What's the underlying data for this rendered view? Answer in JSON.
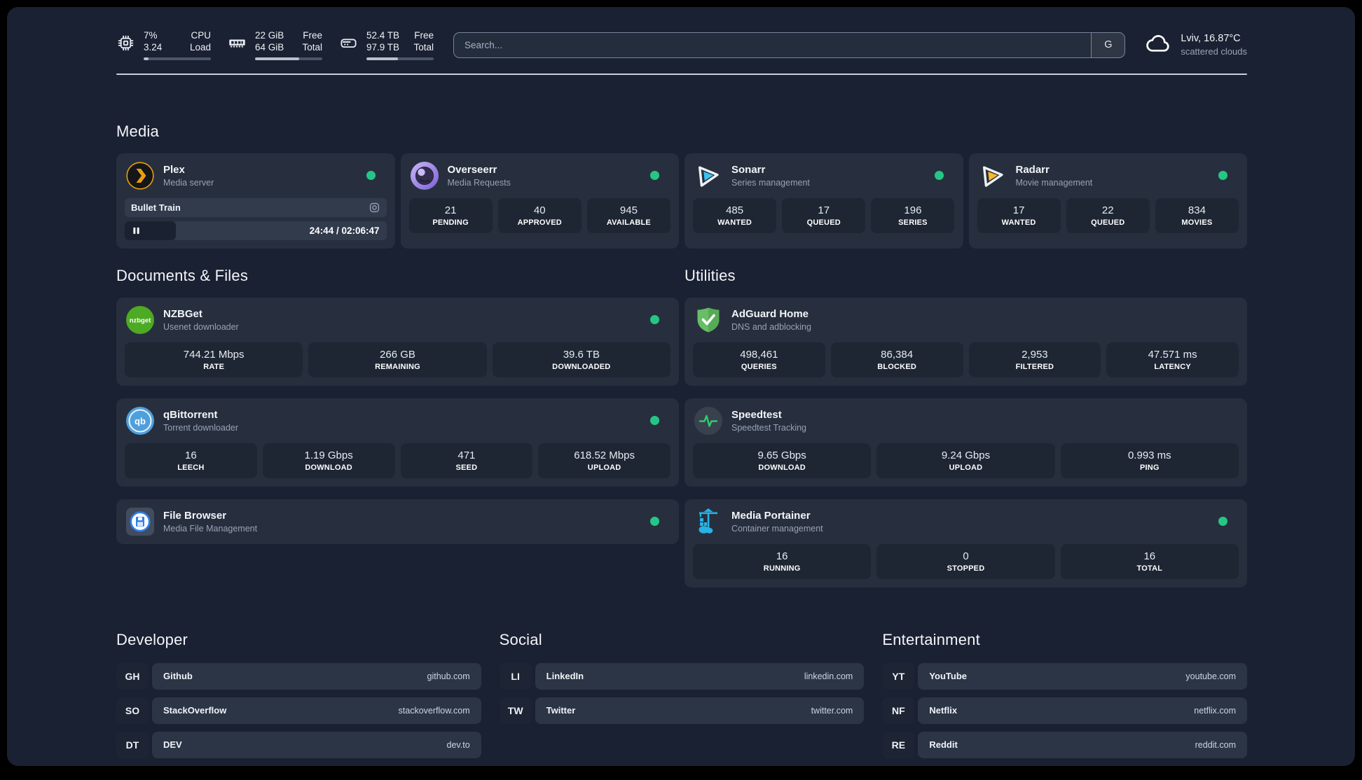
{
  "colors": {
    "status_online": "#25c685",
    "plex_accent": "#e5a00d",
    "sonarr_accent": "#38c3f3",
    "radarr_accent": "#fdb924",
    "nzbget_accent": "#4daa23",
    "qbittorrent_accent": "#4f9fdc",
    "adguard_accent": "#57b358",
    "speedtest_accent": "#2ecc71",
    "portainer_accent": "#29b2e4"
  },
  "header": {
    "stats": [
      {
        "icon": "cpu-icon",
        "rows": [
          [
            "7%",
            "CPU"
          ],
          [
            "3.24",
            "Load"
          ]
        ],
        "progress_pct": 7
      },
      {
        "icon": "ram-icon",
        "rows": [
          [
            "22 GiB",
            "Free"
          ],
          [
            "64 GiB",
            "Total"
          ]
        ],
        "progress_pct": 66
      },
      {
        "icon": "disk-icon",
        "rows": [
          [
            "52.4 TB",
            "Free"
          ],
          [
            "97.9 TB",
            "Total"
          ]
        ],
        "progress_pct": 47
      }
    ],
    "search": {
      "placeholder": "Search...",
      "engine_label": "G"
    },
    "weather": {
      "icon": "cloud-icon",
      "location_temp": "Lviv, 16.87°C",
      "condition": "scattered clouds"
    }
  },
  "sections": {
    "media": {
      "title": "Media",
      "apps": [
        {
          "id": "plex",
          "name": "Plex",
          "subtitle": "Media server",
          "icon": "plex-icon",
          "online": true,
          "now_playing": {
            "title": "Bullet Train",
            "time_display": "24:44 / 02:06:47",
            "progress_pct": 19.5
          }
        },
        {
          "id": "overseerr",
          "name": "Overseerr",
          "subtitle": "Media Requests",
          "icon": "overseerr-icon",
          "online": true,
          "stats": [
            {
              "value": "21",
              "label": "PENDING"
            },
            {
              "value": "40",
              "label": "APPROVED"
            },
            {
              "value": "945",
              "label": "AVAILABLE"
            }
          ]
        },
        {
          "id": "sonarr",
          "name": "Sonarr",
          "subtitle": "Series management",
          "icon": "sonarr-icon",
          "online": true,
          "stats": [
            {
              "value": "485",
              "label": "WANTED"
            },
            {
              "value": "17",
              "label": "QUEUED"
            },
            {
              "value": "196",
              "label": "SERIES"
            }
          ]
        },
        {
          "id": "radarr",
          "name": "Radarr",
          "subtitle": "Movie management",
          "icon": "radarr-icon",
          "online": true,
          "stats": [
            {
              "value": "17",
              "label": "WANTED"
            },
            {
              "value": "22",
              "label": "QUEUED"
            },
            {
              "value": "834",
              "label": "MOVIES"
            }
          ]
        }
      ]
    },
    "documents": {
      "title": "Documents & Files",
      "apps": [
        {
          "id": "nzbget",
          "name": "NZBGet",
          "subtitle": "Usenet downloader",
          "icon": "nzbget-icon",
          "online": true,
          "stats": [
            {
              "value": "744.21 Mbps",
              "label": "RATE"
            },
            {
              "value": "266 GB",
              "label": "REMAINING"
            },
            {
              "value": "39.6 TB",
              "label": "DOWNLOADED"
            }
          ]
        },
        {
          "id": "qbittorrent",
          "name": "qBittorrent",
          "subtitle": "Torrent downloader",
          "icon": "qbittorrent-icon",
          "online": true,
          "stats": [
            {
              "value": "16",
              "label": "LEECH"
            },
            {
              "value": "1.19 Gbps",
              "label": "DOWNLOAD"
            },
            {
              "value": "471",
              "label": "SEED"
            },
            {
              "value": "618.52 Mbps",
              "label": "UPLOAD"
            }
          ]
        },
        {
          "id": "filebrowser",
          "name": "File Browser",
          "subtitle": "Media File Management",
          "icon": "filebrowser-icon",
          "online": true
        }
      ]
    },
    "utilities": {
      "title": "Utilities",
      "apps": [
        {
          "id": "adguard",
          "name": "AdGuard Home",
          "subtitle": "DNS and adblocking",
          "icon": "adguard-icon",
          "online": false,
          "stats": [
            {
              "value": "498,461",
              "label": "QUERIES"
            },
            {
              "value": "86,384",
              "label": "BLOCKED"
            },
            {
              "value": "2,953",
              "label": "FILTERED"
            },
            {
              "value": "47.571 ms",
              "label": "LATENCY"
            }
          ]
        },
        {
          "id": "speedtest",
          "name": "Speedtest",
          "subtitle": "Speedtest Tracking",
          "icon": "speedtest-icon",
          "online": false,
          "stats": [
            {
              "value": "9.65 Gbps",
              "label": "DOWNLOAD"
            },
            {
              "value": "9.24 Gbps",
              "label": "UPLOAD"
            },
            {
              "value": "0.993 ms",
              "label": "PING"
            }
          ]
        },
        {
          "id": "portainer",
          "name": "Media Portainer",
          "subtitle": "Container management",
          "icon": "portainer-icon",
          "online": true,
          "stats": [
            {
              "value": "16",
              "label": "RUNNING"
            },
            {
              "value": "0",
              "label": "STOPPED"
            },
            {
              "value": "16",
              "label": "TOTAL"
            }
          ]
        }
      ]
    },
    "bookmarks": [
      {
        "title": "Developer",
        "links": [
          {
            "abbr": "GH",
            "name": "Github",
            "url": "github.com"
          },
          {
            "abbr": "SO",
            "name": "StackOverflow",
            "url": "stackoverflow.com"
          },
          {
            "abbr": "DT",
            "name": "DEV",
            "url": "dev.to"
          }
        ]
      },
      {
        "title": "Social",
        "links": [
          {
            "abbr": "LI",
            "name": "LinkedIn",
            "url": "linkedin.com"
          },
          {
            "abbr": "TW",
            "name": "Twitter",
            "url": "twitter.com"
          }
        ]
      },
      {
        "title": "Entertainment",
        "links": [
          {
            "abbr": "YT",
            "name": "YouTube",
            "url": "youtube.com"
          },
          {
            "abbr": "NF",
            "name": "Netflix",
            "url": "netflix.com"
          },
          {
            "abbr": "RE",
            "name": "Reddit",
            "url": "reddit.com"
          }
        ]
      }
    ]
  }
}
